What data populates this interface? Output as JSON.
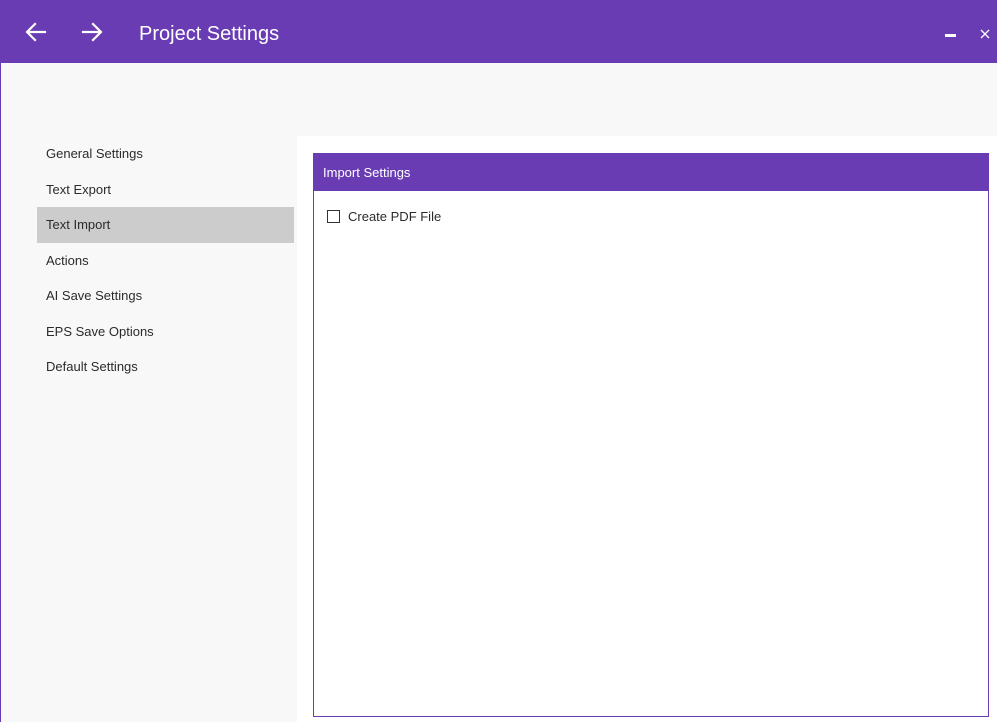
{
  "window": {
    "title": "Project Settings",
    "accent_color": "#6a3cb4",
    "back_icon": "arrow-left-icon",
    "forward_icon": "arrow-right-icon",
    "minimize_icon": "minimize-icon",
    "close_icon": "close-icon"
  },
  "sidebar": {
    "selected": "Text Import",
    "items": [
      {
        "label": "General Settings"
      },
      {
        "label": "Text Export"
      },
      {
        "label": "Text Import"
      },
      {
        "label": "Actions"
      },
      {
        "label": "AI Save Settings"
      },
      {
        "label": "EPS Save Options"
      },
      {
        "label": "Default Settings"
      }
    ]
  },
  "panel": {
    "header": "Import Settings",
    "create_pdf": {
      "label": "Create PDF File",
      "checked": false
    }
  }
}
